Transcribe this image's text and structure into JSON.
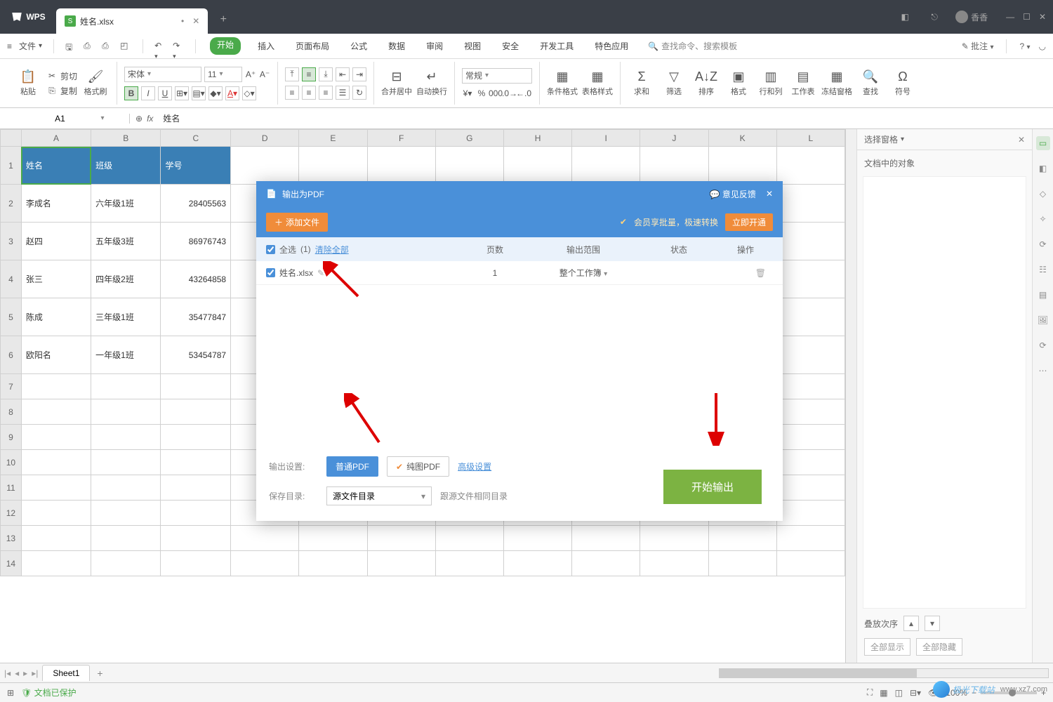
{
  "app": {
    "name": "WPS",
    "doc": "姓名.xlsx",
    "user": "香香"
  },
  "menubar": {
    "file": "文件"
  },
  "tabs": [
    "开始",
    "插入",
    "页面布局",
    "公式",
    "数据",
    "审阅",
    "视图",
    "安全",
    "开发工具",
    "特色应用"
  ],
  "active_tab": "开始",
  "search_placeholder": "查找命令、搜索模板",
  "comment_btn": "批注",
  "ribbon": {
    "paste": "粘贴",
    "cut": "剪切",
    "copy": "复制",
    "format_painter": "格式刷",
    "font": "宋体",
    "size": "11",
    "merge": "合并居中",
    "wrap": "自动换行",
    "numfmt": "常规",
    "cond": "条件格式",
    "tablestyle": "表格样式",
    "sum": "求和",
    "filter": "筛选",
    "sort": "排序",
    "format": "格式",
    "rowcol": "行和列",
    "worksheet": "工作表",
    "freeze": "冻结窗格",
    "find": "查找",
    "symbol": "符号"
  },
  "formula": {
    "cell": "A1",
    "value": "姓名"
  },
  "headers": [
    "A",
    "B",
    "C",
    "D",
    "E",
    "F",
    "G",
    "H",
    "I",
    "J",
    "K",
    "L"
  ],
  "rows": [
    1,
    2,
    3,
    4,
    5,
    6,
    7,
    8,
    9,
    10,
    11,
    12,
    13,
    14
  ],
  "table": {
    "hdr": [
      "姓名",
      "班级",
      "学号"
    ],
    "data": [
      [
        "李成名",
        "六年级1班",
        "28405563"
      ],
      [
        "赵四",
        "五年级3班",
        "86976743"
      ],
      [
        "张三",
        "四年级2班",
        "43264858"
      ],
      [
        "陈成",
        "三年级1班",
        "35477847"
      ],
      [
        "欧阳名",
        "一年级1班",
        "53454787"
      ]
    ]
  },
  "selpane": {
    "title": "选择窗格",
    "sub": "文档中的对象",
    "order": "叠放次序",
    "showall": "全部显示",
    "hideall": "全部隐藏"
  },
  "sheettab": "Sheet1",
  "status": {
    "protected": "文档已保护",
    "zoom": "100%"
  },
  "dialog": {
    "title": "输出为PDF",
    "feedback": "意见反馈",
    "add": "添加文件",
    "promo": "会员享批量，极速转换",
    "open": "立即开通",
    "selectall": "全选",
    "count": "(1)",
    "clear": "清除全部",
    "cols": {
      "pages": "页数",
      "range": "输出范围",
      "status": "状态",
      "ops": "操作"
    },
    "file": "姓名.xlsx",
    "pages": "1",
    "range": "整个工作簿",
    "out_label": "输出设置:",
    "normal": "普通PDF",
    "pure": "纯图PDF",
    "adv": "高级设置",
    "save_label": "保存目录:",
    "save_opt": "源文件目录",
    "save_hint": "跟源文件相同目录",
    "start": "开始输出"
  },
  "watermark": "极光下载站",
  "watermark_url": "www.xz7.com"
}
